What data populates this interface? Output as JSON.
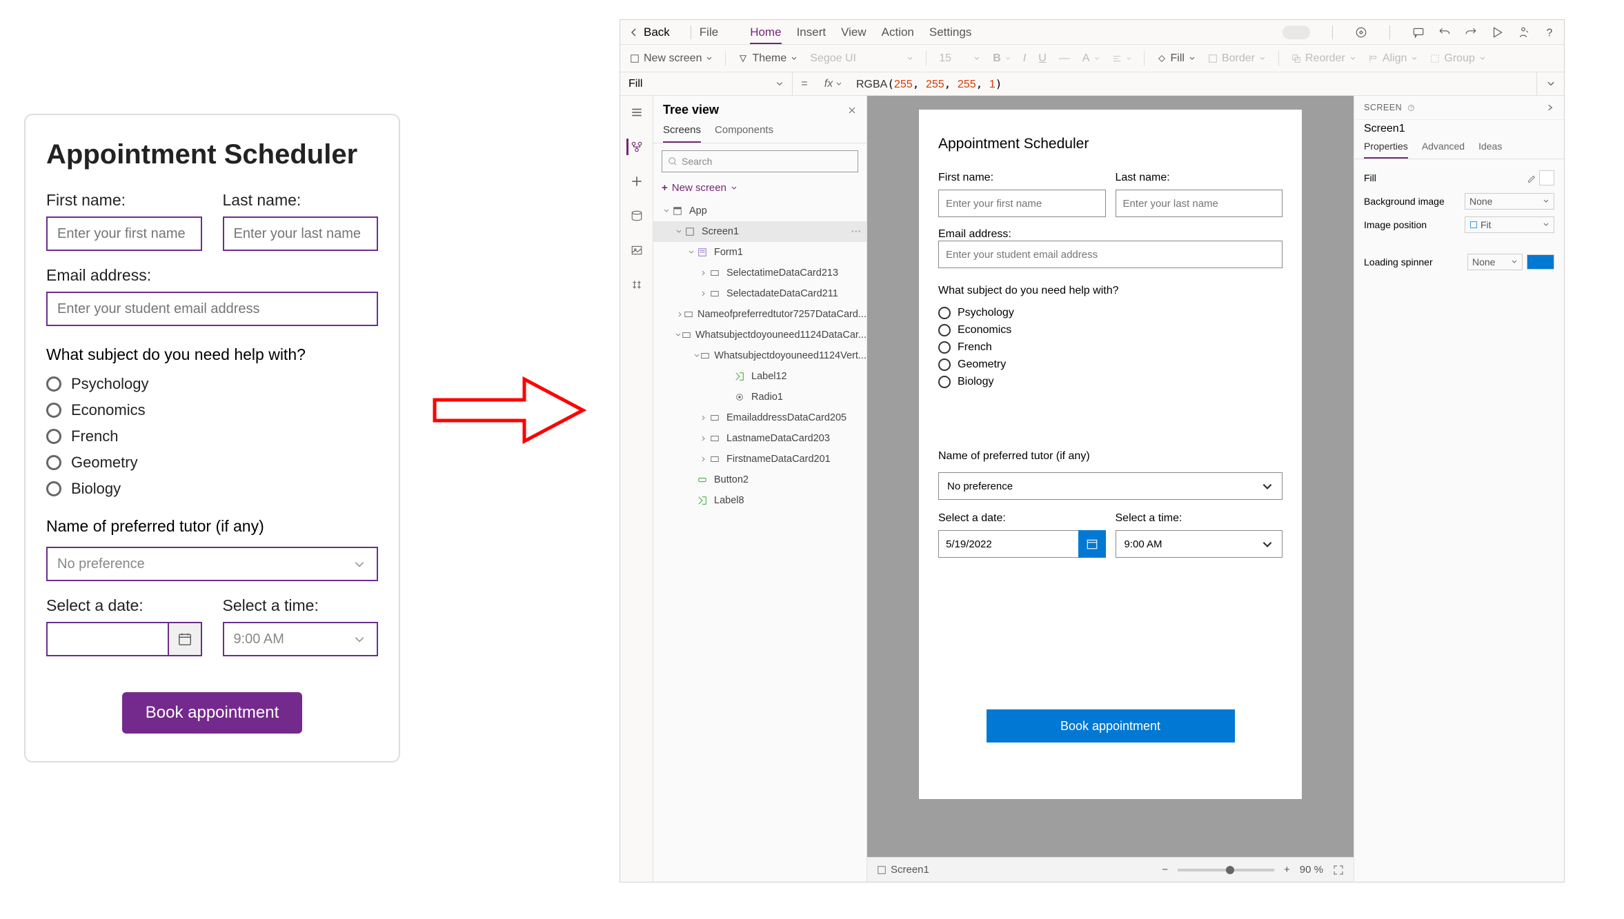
{
  "leftForm": {
    "title": "Appointment Scheduler",
    "firstNameLabel": "First name:",
    "firstNamePh": "Enter your first name",
    "lastNameLabel": "Last name:",
    "lastNamePh": "Enter your last name",
    "emailLabel": "Email address:",
    "emailPh": "Enter your student email address",
    "subjectQ": "What subject do you need help with?",
    "subjects": [
      "Psychology",
      "Economics",
      "French",
      "Geometry",
      "Biology"
    ],
    "tutorLabel": "Name of preferred tutor (if any)",
    "tutorValue": "No preference",
    "dateLabel": "Select a date:",
    "timeLabel": "Select a time:",
    "timeValue": "9:00 AM",
    "bookBtn": "Book appointment"
  },
  "editor": {
    "back": "Back",
    "menus": [
      "File",
      "Home",
      "Insert",
      "View",
      "Action",
      "Settings"
    ],
    "activeMenu": "Home",
    "ribbon": {
      "newScreen": "New screen",
      "theme": "Theme",
      "font": "Segoe UI",
      "size": "15",
      "fill": "Fill",
      "border": "Border",
      "reorder": "Reorder",
      "align": "Align",
      "group": "Group"
    },
    "formula": {
      "prop": "Fill",
      "fn": "RGBA",
      "args": [
        "255",
        "255",
        "255",
        "1"
      ]
    },
    "tree": {
      "title": "Tree view",
      "tabs": [
        "Screens",
        "Components"
      ],
      "searchPh": "Search",
      "newScreen": "New screen",
      "nodes": [
        {
          "depth": 0,
          "label": "App",
          "icon": "app",
          "chev": "down"
        },
        {
          "depth": 1,
          "label": "Screen1",
          "icon": "screen",
          "chev": "down",
          "sel": true,
          "dots": true
        },
        {
          "depth": 2,
          "label": "Form1",
          "icon": "form",
          "chev": "down"
        },
        {
          "depth": 3,
          "label": "SelectatimeDataCard213",
          "icon": "card",
          "chev": "right"
        },
        {
          "depth": 3,
          "label": "SelectadateDataCard211",
          "icon": "card",
          "chev": "right"
        },
        {
          "depth": 3,
          "label": "Nameofpreferredtutor7257DataCard...",
          "icon": "card",
          "chev": "right"
        },
        {
          "depth": 3,
          "label": "Whatsubjectdoyouneed1124DataCar...",
          "icon": "card",
          "chev": "down"
        },
        {
          "depth": 4,
          "label": "Whatsubjectdoyouneed1124Vert...",
          "icon": "card",
          "chev": "down"
        },
        {
          "depth": 5,
          "label": "Label12",
          "icon": "label"
        },
        {
          "depth": 5,
          "label": "Radio1",
          "icon": "radio"
        },
        {
          "depth": 3,
          "label": "EmailaddressDataCard205",
          "icon": "card",
          "chev": "right"
        },
        {
          "depth": 3,
          "label": "LastnameDataCard203",
          "icon": "card",
          "chev": "right"
        },
        {
          "depth": 3,
          "label": "FirstnameDataCard201",
          "icon": "card",
          "chev": "right"
        },
        {
          "depth": 2,
          "label": "Button2",
          "icon": "button"
        },
        {
          "depth": 2,
          "label": "Label8",
          "icon": "label"
        }
      ]
    },
    "appScreen": {
      "title": "Appointment Scheduler",
      "firstNameLabel": "First name:",
      "firstNamePh": "Enter your first name",
      "lastNameLabel": "Last name:",
      "lastNamePh": "Enter your last name",
      "emailLabel": "Email address:",
      "emailPh": "Enter your student email address",
      "subjectQ": "What subject do you need help with?",
      "subjects": [
        "Psychology",
        "Economics",
        "French",
        "Geometry",
        "Biology"
      ],
      "tutorLabel": "Name of preferred tutor (if any)",
      "tutorValue": "No preference",
      "dateLabel": "Select a date:",
      "dateValue": "5/19/2022",
      "timeLabel": "Select a time:",
      "timeValue": "9:00 AM",
      "bookBtn": "Book appointment"
    },
    "footer": {
      "screenName": "Screen1",
      "zoom": "90 %"
    },
    "props": {
      "heading": "SCREEN",
      "name": "Screen1",
      "tabs": [
        "Properties",
        "Advanced",
        "Ideas"
      ],
      "rows": {
        "fill": "Fill",
        "bgImage": "Background image",
        "bgImageVal": "None",
        "imgPos": "Image position",
        "imgPosVal": "Fit",
        "spinner": "Loading spinner",
        "spinnerVal": "None"
      }
    }
  }
}
